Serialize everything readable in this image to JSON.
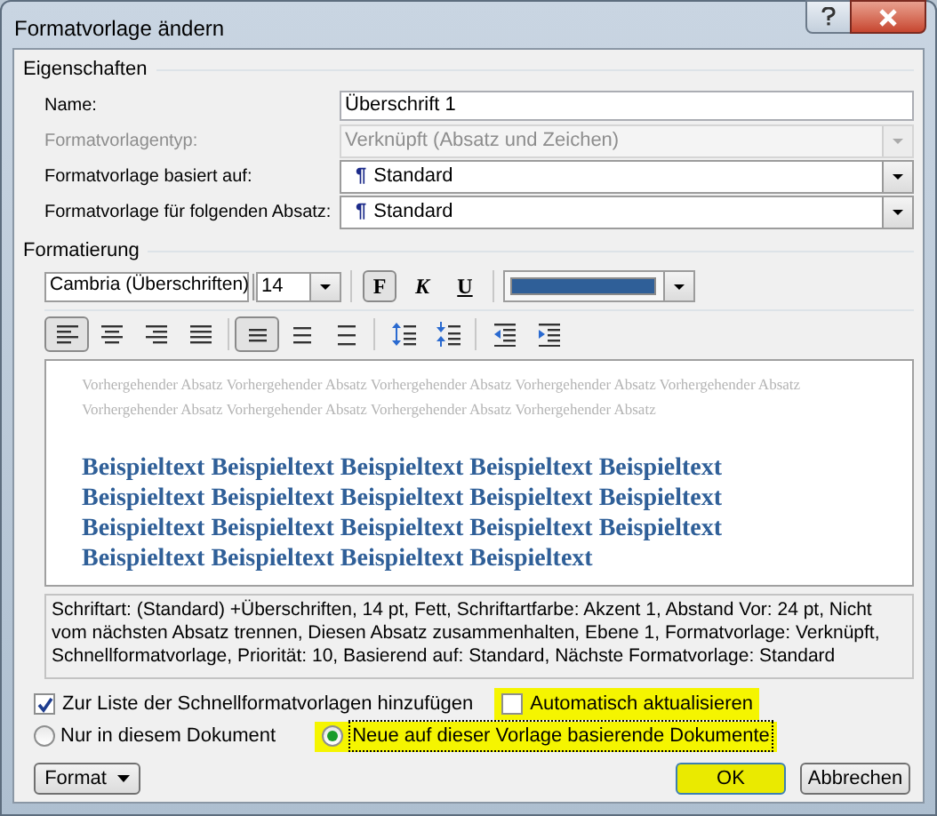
{
  "window": {
    "title": "Formatvorlage ändern"
  },
  "properties": {
    "label": "Eigenschaften",
    "fields": [
      {
        "label": "Name:",
        "kind": "text",
        "value": "Überschrift 1",
        "disabled": false
      },
      {
        "label": "Formatvorlagentyp:",
        "kind": "dropdown",
        "value": "Verknüpft (Absatz und Zeichen)",
        "disabled": true
      },
      {
        "label": "Formatvorlage basiert auf:",
        "kind": "dropdown",
        "value": "Standard",
        "pilcrow": "¶",
        "disabled": false
      },
      {
        "label": "Formatvorlage für folgenden Absatz:",
        "kind": "dropdown",
        "value": "Standard",
        "pilcrow": "¶",
        "disabled": false
      }
    ]
  },
  "formatting": {
    "label": "Formatierung",
    "font": "Cambria (Überschriften)",
    "size": "14",
    "styles": [
      {
        "label": "F",
        "kind": "bold",
        "selected": true
      },
      {
        "label": "K",
        "kind": "italic",
        "selected": false
      },
      {
        "label": "U",
        "kind": "underline",
        "selected": false
      }
    ],
    "font_color": {
      "color": "#2f5f98"
    },
    "alignment": [
      {
        "kind": "left",
        "selected": true
      },
      {
        "kind": "center",
        "selected": false
      },
      {
        "kind": "right",
        "selected": false
      },
      {
        "kind": "justify",
        "selected": false
      }
    ],
    "line_spacing": [
      {
        "kind": "single",
        "selected": true
      },
      {
        "kind": "onehalf",
        "selected": false
      },
      {
        "kind": "double",
        "selected": false
      }
    ],
    "paragraph_spacing": [
      {
        "kind": "increase"
      },
      {
        "kind": "decrease"
      }
    ],
    "indent": [
      {
        "kind": "decrease"
      },
      {
        "kind": "increase"
      }
    ]
  },
  "preview": {
    "previous": "Vorhergehender Absatz Vorhergehender Absatz Vorhergehender Absatz Vorhergehender Absatz Vorhergehender Absatz Vorhergehender Absatz Vorhergehender Absatz Vorhergehender Absatz Vorhergehender Absatz",
    "sample": "Beispieltext Beispieltext Beispieltext Beispieltext Beispieltext Beispieltext Beispieltext Beispieltext Beispieltext Beispieltext Beispieltext Beispieltext Beispieltext Beispieltext Beispieltext Beispieltext Beispieltext Beispieltext Beispieltext"
  },
  "description": "Schriftart: (Standard) +Überschriften, 14 pt, Fett, Schriftartfarbe: Akzent 1, Abstand Vor:  24 pt, Nicht vom nächsten Absatz trennen, Diesen Absatz zusammenhalten, Ebene 1, Formatvorlage: Verknüpft, Schnellformatvorlage, Priorität: 10, Basierend auf: Standard, Nächste Formatvorlage: Standard",
  "checkboxes": [
    {
      "label": "Zur Liste der Schnellformatvorlagen hinzufügen",
      "checked": true,
      "highlighted": false
    },
    {
      "label": "Automatisch aktualisieren",
      "checked": false,
      "highlighted": true
    }
  ],
  "radios": [
    {
      "label": "Nur in diesem Dokument",
      "selected": false,
      "highlighted": false
    },
    {
      "label": "Neue auf dieser Vorlage basierende Dokumente",
      "selected": true,
      "highlighted": true
    }
  ],
  "buttons": [
    {
      "label": "Format",
      "kind": "menu",
      "highlighted": false
    },
    {
      "label": "OK",
      "kind": "default",
      "highlighted": true
    },
    {
      "label": "Abbrechen",
      "kind": "cancel",
      "highlighted": false
    }
  ]
}
